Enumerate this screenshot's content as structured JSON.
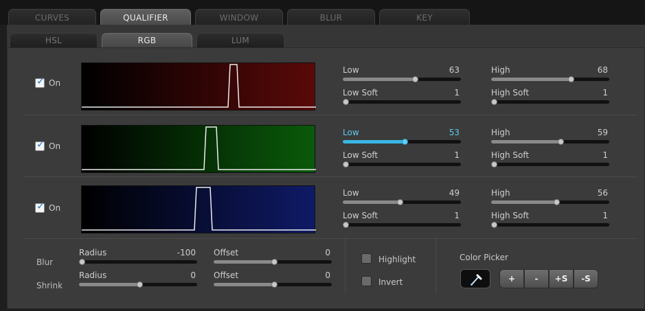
{
  "main_tabs": [
    {
      "label": "CURVES"
    },
    {
      "label": "QUALIFIER"
    },
    {
      "label": "WINDOW"
    },
    {
      "label": "BLUR"
    },
    {
      "label": "KEY"
    }
  ],
  "sub_tabs": [
    {
      "label": "HSL"
    },
    {
      "label": "RGB"
    },
    {
      "label": "LUM"
    }
  ],
  "channels": [
    {
      "on_label": "On",
      "checked": true,
      "low": {
        "label": "Low",
        "value": "63",
        "level": 0.63
      },
      "low_soft": {
        "label": "Low Soft",
        "value": "1",
        "level": 0.01
      },
      "high": {
        "label": "High",
        "value": "68",
        "level": 0.68
      },
      "high_soft": {
        "label": "High Soft",
        "value": "1",
        "level": 0.01
      }
    },
    {
      "on_label": "On",
      "checked": true,
      "low": {
        "label": "Low",
        "value": "53",
        "level": 0.53
      },
      "low_soft": {
        "label": "Low Soft",
        "value": "1",
        "level": 0.01
      },
      "high": {
        "label": "High",
        "value": "59",
        "level": 0.59
      },
      "high_soft": {
        "label": "High Soft",
        "value": "1",
        "level": 0.01
      }
    },
    {
      "on_label": "On",
      "checked": true,
      "low": {
        "label": "Low",
        "value": "49",
        "level": 0.49
      },
      "low_soft": {
        "label": "Low Soft",
        "value": "1",
        "level": 0.01
      },
      "high": {
        "label": "High",
        "value": "56",
        "level": 0.56
      },
      "high_soft": {
        "label": "High Soft",
        "value": "1",
        "level": 0.01
      }
    }
  ],
  "blur": {
    "label": "Blur",
    "radius": {
      "label": "Radius",
      "value": "-100",
      "level": 0.0
    },
    "offset": {
      "label": "Offset",
      "value": "0",
      "level": 0.5
    }
  },
  "shrink": {
    "label": "Shrink",
    "radius": {
      "label": "Radius",
      "value": "0",
      "level": 0.5
    },
    "offset": {
      "label": "Offset",
      "value": "0",
      "level": 0.5
    }
  },
  "options": {
    "highlight": "Highlight",
    "invert": "Invert"
  },
  "color_picker": {
    "label": "Color Picker",
    "buttons": [
      "+",
      "-",
      "+S",
      "-S"
    ]
  },
  "colors": {
    "red": "#5a0909",
    "green": "#0a5a0a",
    "blue": "#0f1a66",
    "accent": "#3ab6e4"
  }
}
